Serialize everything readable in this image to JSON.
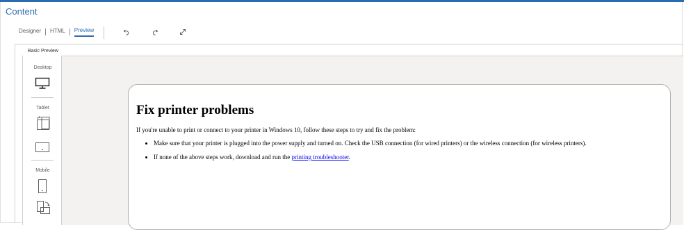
{
  "header": {
    "title": "Content"
  },
  "modes": {
    "designer": "Designer",
    "html": "HTML",
    "preview": "Preview"
  },
  "toolbar": {
    "undo_icon": "undo-icon",
    "redo_icon": "redo-icon",
    "expand_icon": "expand-icon"
  },
  "preview_panel": {
    "label": "Basic Preview",
    "devices": {
      "desktop": "Desktop",
      "tablet": "Tablet",
      "mobile": "Mobile"
    }
  },
  "content": {
    "heading": "Fix printer problems",
    "intro": "If you're unable to print or connect to your printer in Windows 10, follow these steps to try and fix the problem:",
    "bullet1": "Make sure that your printer is plugged into the power supply and turned on. Check the USB connection (for wired printers) or the wireless connection (for wireless printers).",
    "bullet2_before": "If none of the above steps work, download and run the ",
    "bullet2_link": "printing troubleshooter",
    "bullet2_after": "."
  },
  "colors": {
    "accent": "#2b6cb0",
    "link": "#0000ee",
    "canvas": "#f3f2f1"
  }
}
